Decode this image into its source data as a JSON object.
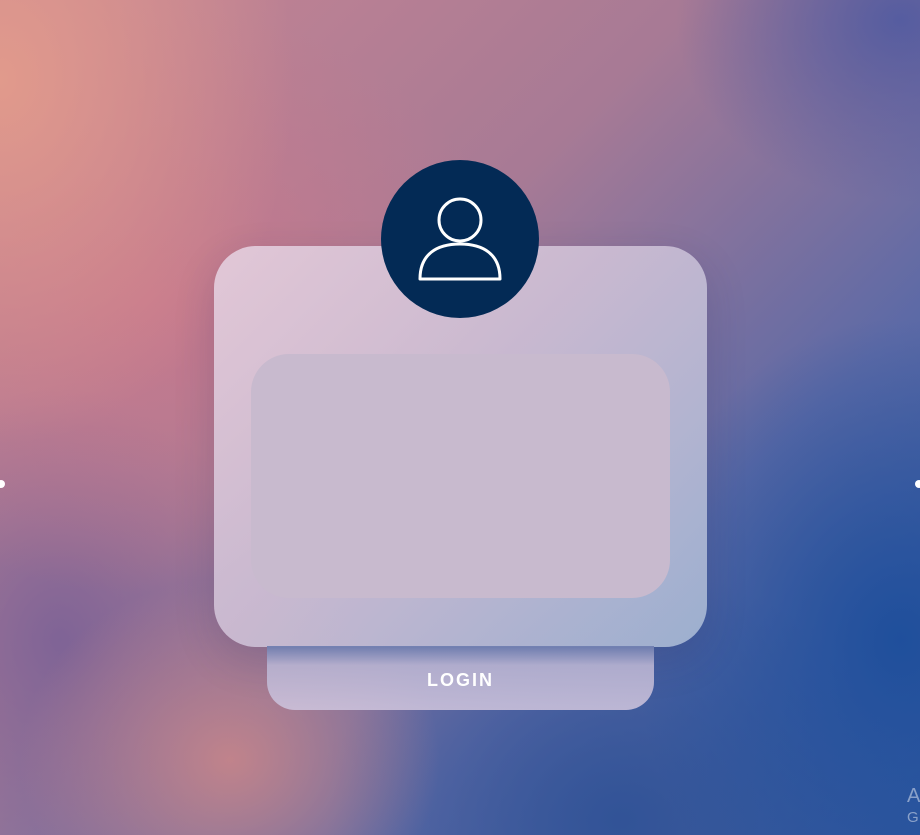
{
  "login_card": {
    "login_button_label": "LOGIN"
  },
  "avatar": {
    "icon": "user-icon"
  },
  "watermark": {
    "line1": "A",
    "line2": "G"
  },
  "colors": {
    "avatar_background": "#032a55",
    "card_inner": "#c8bace",
    "background_warm": "#e19a8c",
    "background_cool": "#1f4f9c"
  }
}
